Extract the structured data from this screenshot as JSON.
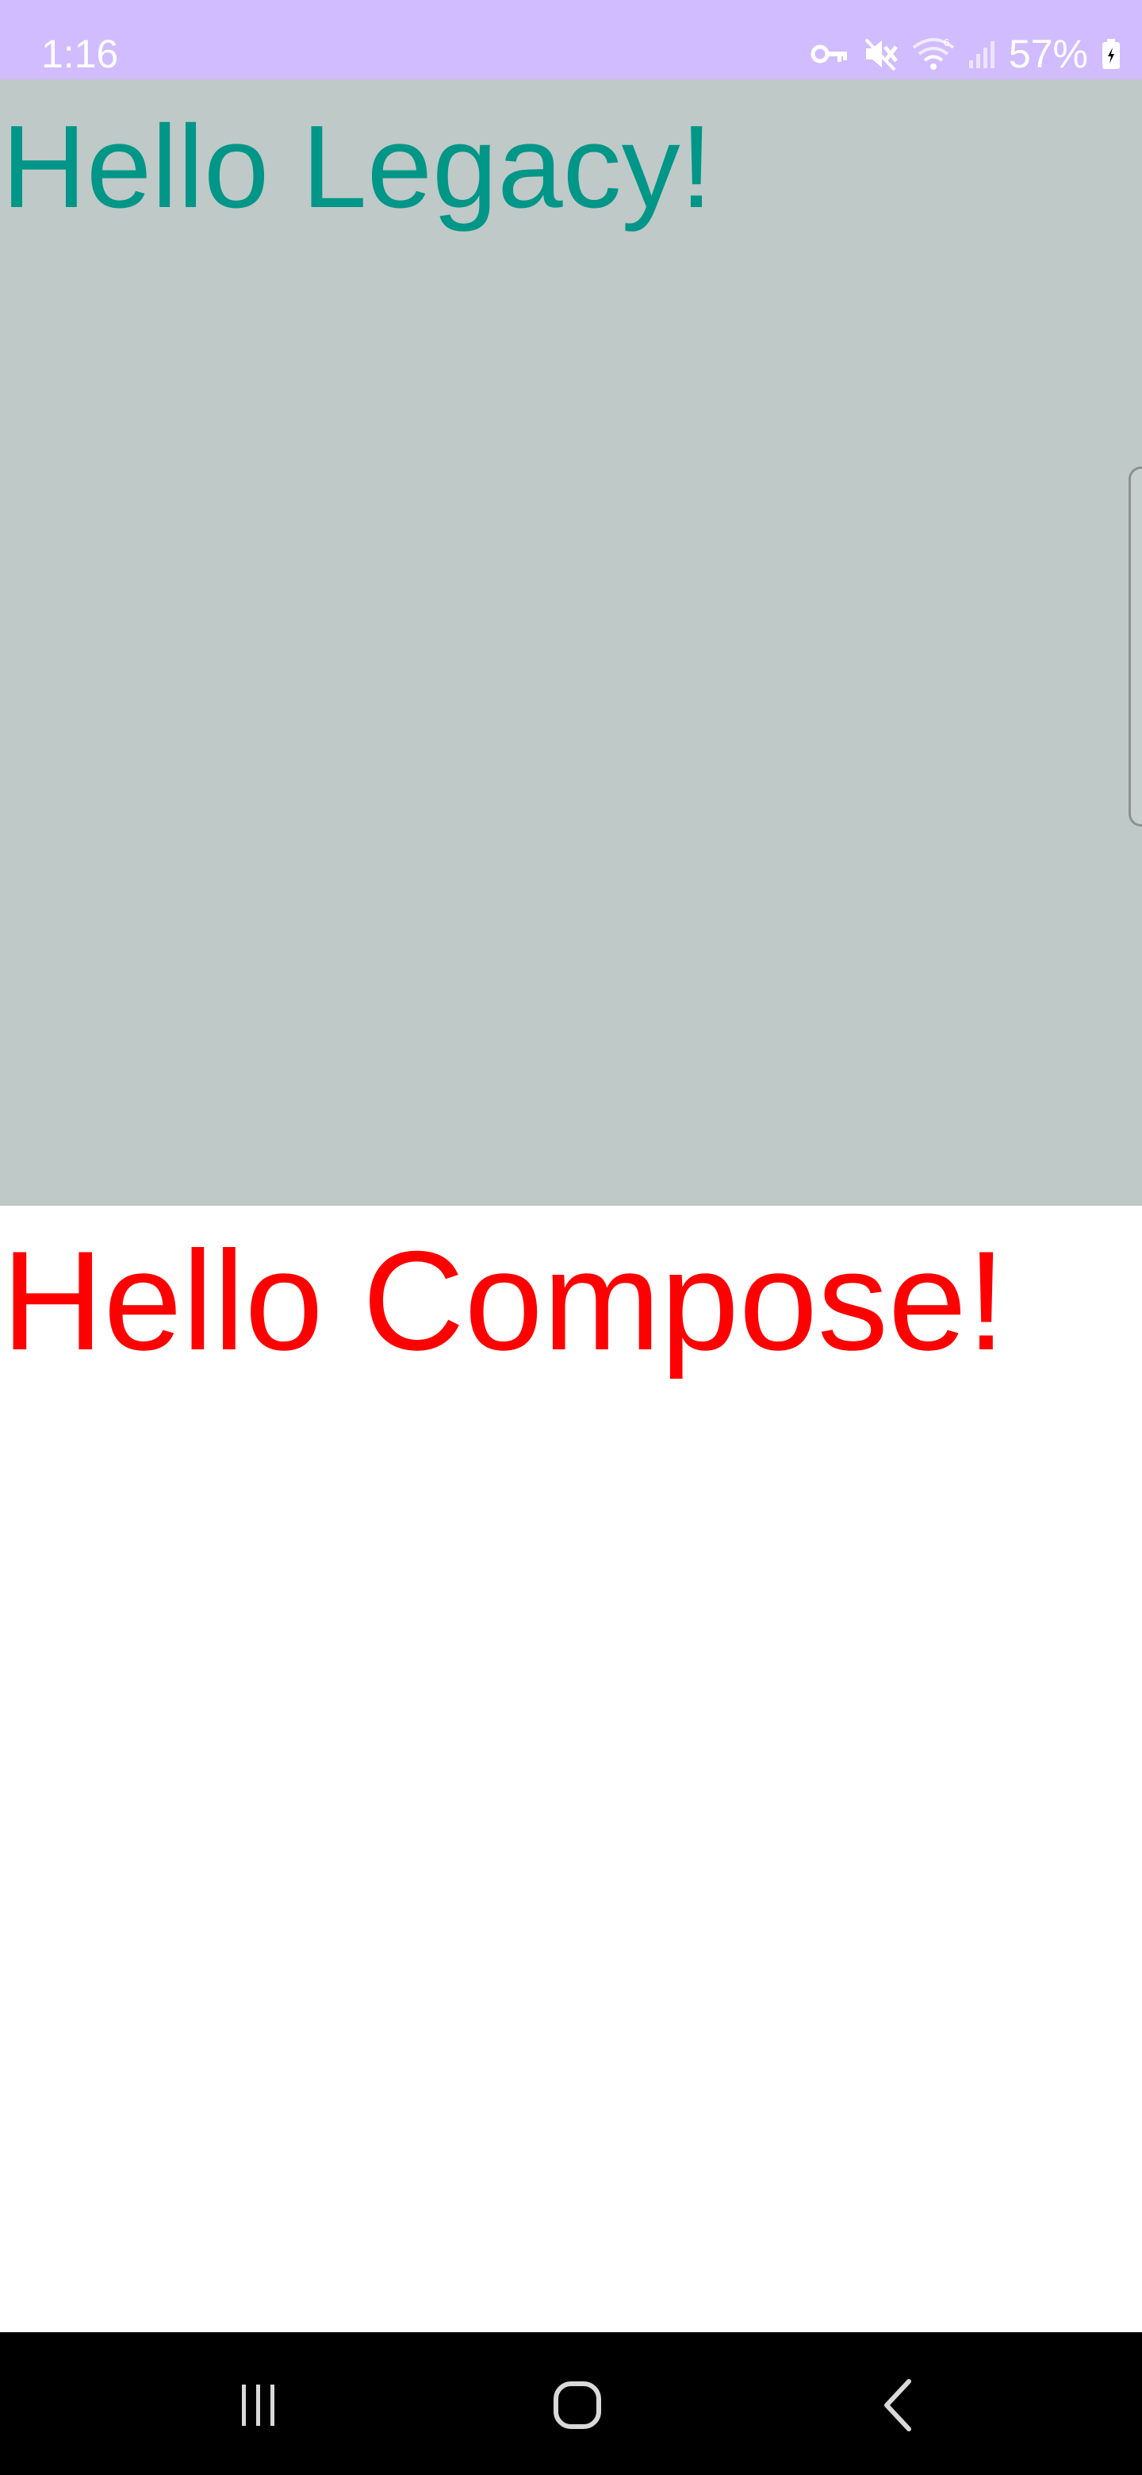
{
  "status_bar": {
    "time": "1:16",
    "battery": "57%",
    "icons": [
      "vpn-key-icon",
      "mute-icon",
      "wifi-icon",
      "signal-icon",
      "battery-icon"
    ]
  },
  "legacy": {
    "text": "Hello Legacy!",
    "text_color": "#009688",
    "background": "#bfc9c7"
  },
  "compose": {
    "text": "Hello Compose!",
    "text_color": "#ff0000",
    "background": "#ffffff"
  },
  "colors": {
    "status_bar": "#d0bcff",
    "nav_bar": "#000000"
  },
  "nav_bar": {
    "buttons": [
      "recents-icon",
      "home-icon",
      "back-icon"
    ]
  }
}
